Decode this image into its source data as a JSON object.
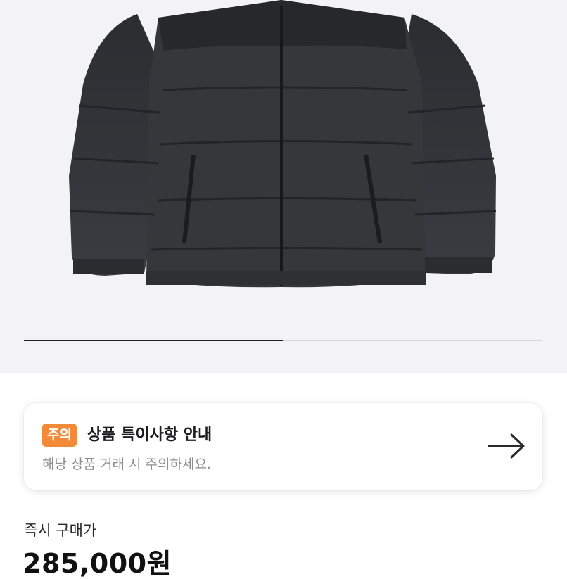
{
  "gallery": {
    "image_description": "dark gray puffer jacket product photo",
    "progress_fraction": 0.5
  },
  "notice": {
    "badge": "주의",
    "title": "상품 특이사항 안내",
    "subtitle": "해당 상품 거래 시 주의하세요.",
    "icon": "arrow-right-icon"
  },
  "price": {
    "label": "즉시 구매가",
    "value": "285,000원"
  }
}
